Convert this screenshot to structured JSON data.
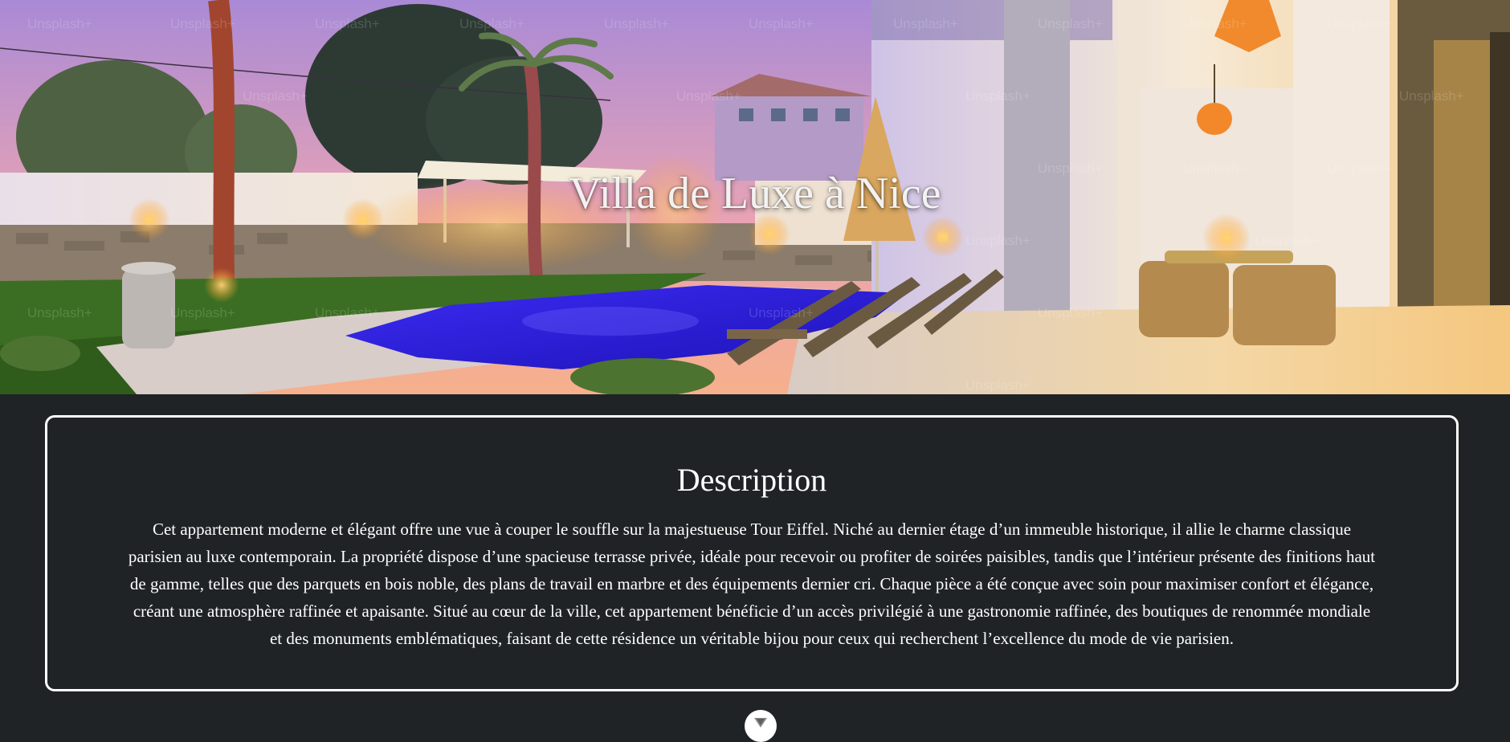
{
  "hero": {
    "title": "Villa de Luxe à Nice",
    "image_subject": "pool-villa-at-dusk",
    "watermark_text": "Unsplash+",
    "colors": {
      "sky_top": "#a98ad6",
      "sky_bottom": "#f1a28a",
      "pool": "#2d1fe0",
      "lamp_glow": "#ffb43a",
      "grass": "#3b6e22"
    }
  },
  "description": {
    "title": "Description",
    "text": "Cet appartement moderne et élégant offre une vue à couper le souffle sur la majestueuse Tour Eiffel. Niché au dernier étage d’un immeuble historique, il allie le charme classique parisien au luxe contemporain. La propriété dispose d’une spacieuse terrasse privée, idéale pour recevoir ou profiter de soirées paisibles, tandis que l’intérieur présente des finitions haut de gamme, telles que des parquets en bois noble, des plans de travail en marbre et des équipements dernier cri. Chaque pièce a été conçue avec soin pour maximiser confort et élégance, créant une atmosphère raffinée et apaisante. Situé au cœur de la ville, cet appartement bénéficie d’un accès privilégié à une gastronomie raffinée, des boutiques de renommée mondiale et des monuments emblématiques, faisant de cette résidence un véritable bijou pour ceux qui recherchent l’excellence du mode de vie parisien."
  },
  "scroll_button": {
    "icon": "chevron-down-icon"
  },
  "theme": {
    "page_background": "#1f2325",
    "card_border": "#ffffff",
    "text": "#ffffff"
  }
}
